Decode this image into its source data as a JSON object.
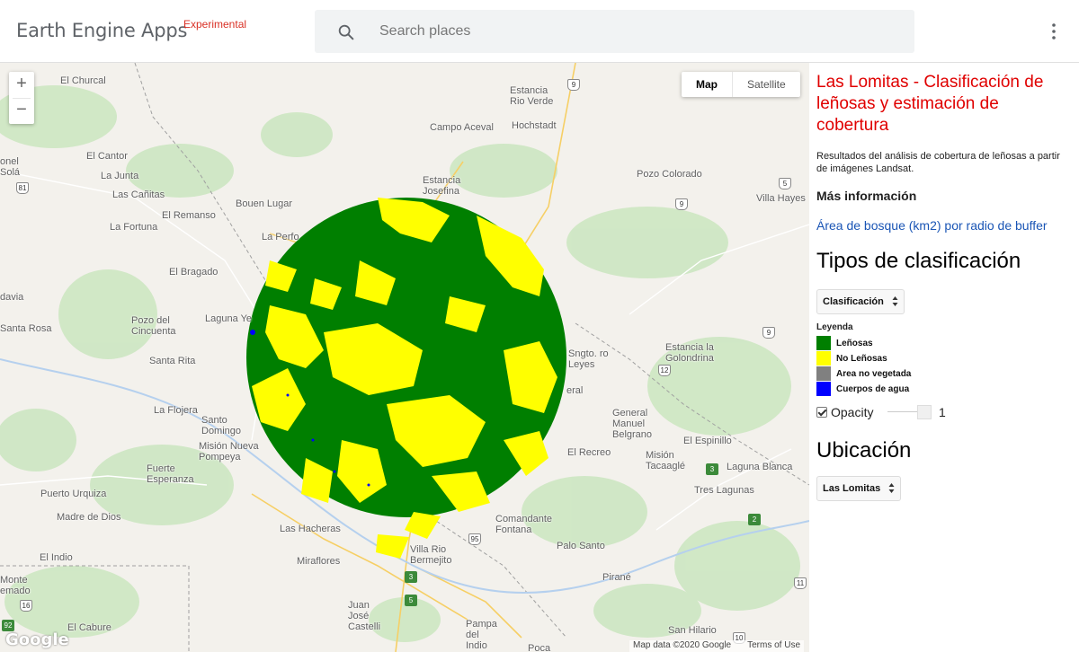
{
  "app": {
    "brand": "Earth Engine Apps",
    "badge": "Experimental",
    "search_placeholder": "Search places",
    "menu_icon": "more-vert-icon"
  },
  "map": {
    "zoom_in": "+",
    "zoom_out": "−",
    "map_type_map": "Map",
    "map_type_satellite": "Satellite",
    "google_logo": "Google",
    "attribution": "Map data ©2020 Google",
    "terms": "Terms of Use",
    "layer_colors": {
      "lenosas": "#007f00",
      "no_lenosas": "#ffff00",
      "agua": "#0000ff"
    },
    "places": [
      "El Churcal",
      "Estancia Rio Verde",
      "Hochstadt",
      "Campo Aceval",
      "El Cantor",
      "onel Solá",
      "La Junta",
      "Las Cañitas",
      "El Remanso",
      "Bouen Lugar",
      "La Fortuna",
      "La Perfo",
      "Estancia Josefina",
      "Pozo Colorado",
      "Villa Hayes",
      "El Bragado",
      "davia",
      "Pozo del Cincuenta",
      "Laguna Ye",
      "Santa Rosa",
      "Santa Rita",
      "Sngto. ro Leyes",
      "Estancia la Golondrina",
      "La Flojera",
      "Santo Domingo",
      "eral",
      "General Manuel Belgrano",
      "Misión Nueva Pompeya",
      "El Recreo",
      "El Espinillo",
      "Fuerte Esperanza",
      "Misión Tacaaglé",
      "Laguna Blanca",
      "Puerto Urquiza",
      "Tres Lagunas",
      "Madre de Dios",
      "Comandante Fontana",
      "Las Hacheras",
      "Palo Santo",
      "Villa Rio Bermejito",
      "El Indio",
      "Miraflores",
      "Monte emado",
      "Pirané",
      "Juan José Castelli",
      "El Cabure",
      "Pampa del Indio",
      "San Hilario",
      "Poca"
    ],
    "route_shields": [
      "9",
      "81",
      "9",
      "5",
      "9",
      "12",
      "3",
      "95",
      "2",
      "3",
      "5",
      "16",
      "92",
      "11",
      "10",
      "5"
    ]
  },
  "panel": {
    "title": "Las Lomitas - Clasificación de leñosas y estimación de cobertura",
    "description": "Resultados del análisis de cobertura de leñosas a partir de imágenes Landsat.",
    "more_info": "Más información",
    "link": "Área de bosque (km2) por radio de buffer",
    "section_classification": "Tipos de clasificación",
    "classification_select": "Clasificación",
    "legend_title": "Leyenda",
    "legend": [
      {
        "label": "Leñosas",
        "color": "#007f00"
      },
      {
        "label": "No Leñosas",
        "color": "#ffff00"
      },
      {
        "label": "Area no vegetada",
        "color": "#808080"
      },
      {
        "label": "Cuerpos de agua",
        "color": "#0000ff"
      }
    ],
    "opacity_label": "Opacity",
    "opacity_value": "1",
    "section_location": "Ubicación",
    "location_select": "Las Lomitas"
  }
}
